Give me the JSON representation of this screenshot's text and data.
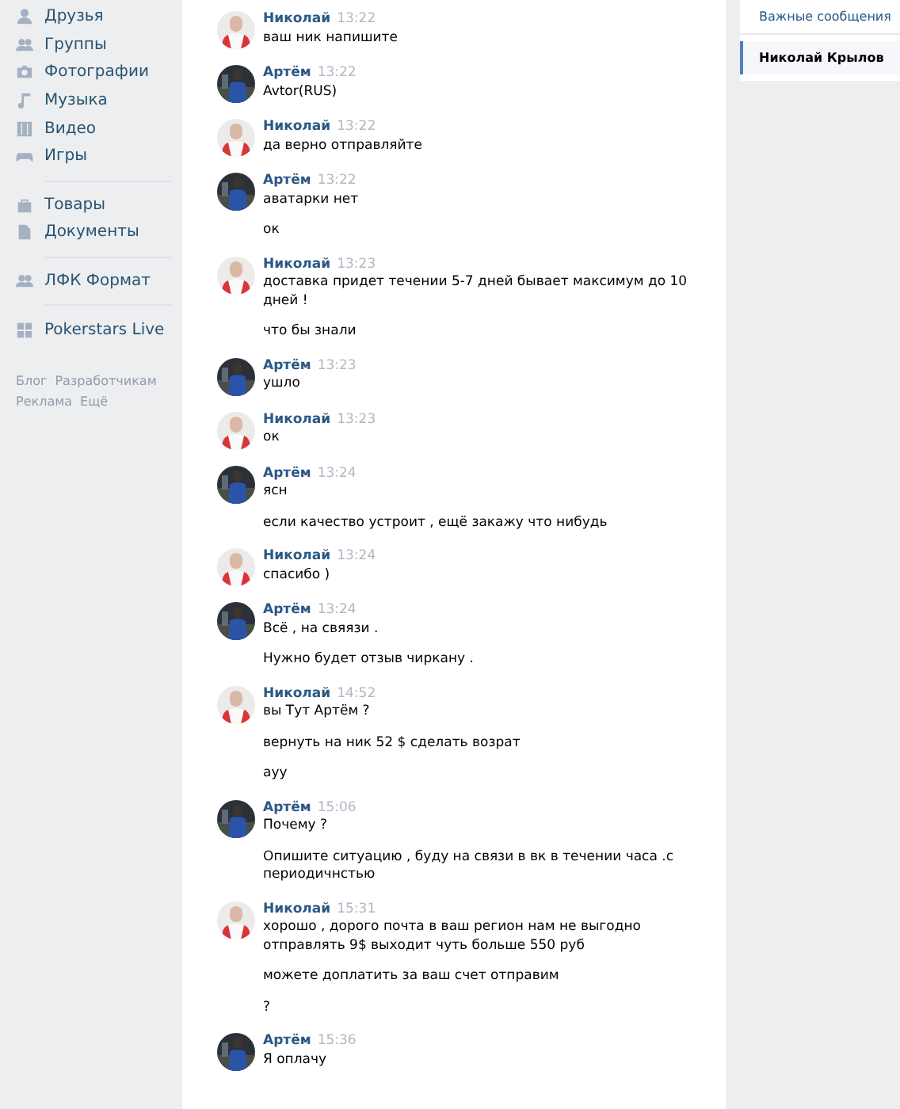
{
  "sidebar": {
    "groups": [
      [
        {
          "label": "Друзья",
          "kind": "person"
        },
        {
          "label": "Группы",
          "kind": "people"
        },
        {
          "label": "Фотографии",
          "kind": "camera"
        },
        {
          "label": "Музыка",
          "kind": "note"
        },
        {
          "label": "Видео",
          "kind": "film"
        },
        {
          "label": "Игры",
          "kind": "gamepad"
        }
      ],
      [
        {
          "label": "Товары",
          "kind": "bag"
        },
        {
          "label": "Документы",
          "kind": "doc"
        }
      ],
      [
        {
          "label": "ЛФК Формат",
          "kind": "people"
        }
      ],
      [
        {
          "label": "Pokerstars Live",
          "kind": "grid"
        }
      ]
    ],
    "footer": [
      [
        "Блог",
        "Разработчикам"
      ],
      [
        "Реклама",
        "Ещё"
      ]
    ]
  },
  "messages": [
    {
      "author": "Николай",
      "kind": "light",
      "time": "13:22",
      "texts": [
        "ваш ник напишите"
      ]
    },
    {
      "author": "Артём",
      "kind": "dark",
      "time": "13:22",
      "texts": [
        "Avtor(RUS)"
      ]
    },
    {
      "author": "Николай",
      "kind": "light",
      "time": "13:22",
      "texts": [
        "да верно отправляйте"
      ]
    },
    {
      "author": "Артём",
      "kind": "dark",
      "time": "13:22",
      "texts": [
        "аватарки нет",
        "ок"
      ]
    },
    {
      "author": "Николай",
      "kind": "light",
      "time": "13:23",
      "texts": [
        "доставка придет течении 5-7 дней бывает максимум до 10 дней !",
        "что бы знали"
      ]
    },
    {
      "author": "Артём",
      "kind": "dark",
      "time": "13:23",
      "texts": [
        "ушло"
      ]
    },
    {
      "author": "Николай",
      "kind": "light",
      "time": "13:23",
      "texts": [
        "ок"
      ]
    },
    {
      "author": "Артём",
      "kind": "dark",
      "time": "13:24",
      "texts": [
        "ясн",
        "если качество устроит , ещё закажу что нибудь"
      ]
    },
    {
      "author": "Николай",
      "kind": "light",
      "time": "13:24",
      "texts": [
        "спасибо )"
      ]
    },
    {
      "author": "Артём",
      "kind": "dark",
      "time": "13:24",
      "texts": [
        "Всё , на свяязи .",
        "Нужно будет отзыв чиркану ."
      ]
    },
    {
      "author": "Николай",
      "kind": "light",
      "time": "14:52",
      "texts": [
        "вы Тут Артём ?",
        "вернуть на ник 52 $ сделать возрат",
        "ауу"
      ]
    },
    {
      "author": "Артём",
      "kind": "dark",
      "time": "15:06",
      "texts": [
        "Почему ?",
        "Опишите ситуацию , буду на связи в вк в течении часа .с периодичнстью"
      ]
    },
    {
      "author": "Николай",
      "kind": "light",
      "time": "15:31",
      "texts": [
        "хорошо , дорого почта в ваш регион нам не выгодно отправлять 9$ выходит чуть больше 550 руб",
        "можете доплатить за ваш счет отправим",
        "?"
      ]
    },
    {
      "author": "Артём",
      "kind": "dark",
      "time": "15:36",
      "texts": [
        "Я оплачу"
      ]
    }
  ],
  "right_panel": {
    "items": [
      {
        "label": "Важные сообщения",
        "selected": false
      },
      {
        "label": "Николай Крылов",
        "selected": true
      }
    ]
  }
}
